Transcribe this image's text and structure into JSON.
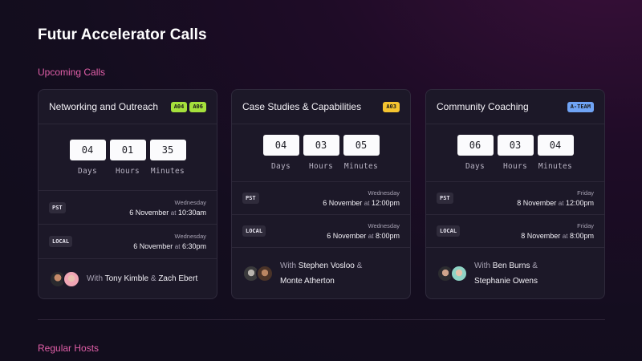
{
  "page_title": "Futur Accelerator Calls",
  "sections": {
    "upcoming_label": "Upcoming Calls",
    "hosts_label": "Regular Hosts"
  },
  "cards": [
    {
      "title": "Networking and Outreach",
      "tags": [
        {
          "label": "A04",
          "color": "#a5e03c"
        },
        {
          "label": "A06",
          "color": "#a5e03c"
        }
      ],
      "countdown": {
        "days": "04",
        "hours": "01",
        "minutes": "35",
        "days_label": "Days",
        "hours_label": "Hours",
        "minutes_label": "Minutes"
      },
      "times": [
        {
          "tz": "PST",
          "day": "Wednesday",
          "date": "6 November",
          "at": "at",
          "time": "10:30am"
        },
        {
          "tz": "LOCAL",
          "day": "Wednesday",
          "date": "6 November",
          "at": "at",
          "time": "6:30pm"
        }
      ],
      "hosts": {
        "prefix": "With",
        "host1": "Tony Kimble",
        "amp": "&",
        "host2": "Zach Ebert"
      },
      "avatars": [
        "avatar-tony-kimble",
        "avatar-zach-ebert"
      ]
    },
    {
      "title": "Case Studies & Capabilities",
      "tags": [
        {
          "label": "A03",
          "color": "#f5c430"
        }
      ],
      "countdown": {
        "days": "04",
        "hours": "03",
        "minutes": "05",
        "days_label": "Days",
        "hours_label": "Hours",
        "minutes_label": "Minutes"
      },
      "times": [
        {
          "tz": "PST",
          "day": "Wednesday",
          "date": "6 November",
          "at": "at",
          "time": "12:00pm"
        },
        {
          "tz": "LOCAL",
          "day": "Wednesday",
          "date": "6 November",
          "at": "at",
          "time": "8:00pm"
        }
      ],
      "hosts": {
        "prefix": "With",
        "host1": "Stephen Vosloo",
        "amp": "&",
        "host2": "Monte Atherton"
      },
      "avatars": [
        "avatar-stephen-vosloo",
        "avatar-monte-atherton"
      ]
    },
    {
      "title": "Community Coaching",
      "tags": [
        {
          "label": "A-TEAM",
          "color": "#6fa3f5"
        }
      ],
      "countdown": {
        "days": "06",
        "hours": "03",
        "minutes": "04",
        "days_label": "Days",
        "hours_label": "Hours",
        "minutes_label": "Minutes"
      },
      "times": [
        {
          "tz": "PST",
          "day": "Friday",
          "date": "8 November",
          "at": "at",
          "time": "12:00pm"
        },
        {
          "tz": "LOCAL",
          "day": "Friday",
          "date": "8 November",
          "at": "at",
          "time": "8:00pm"
        }
      ],
      "hosts": {
        "prefix": "With",
        "host1": "Ben Burns",
        "amp": "&",
        "host2": "Stephanie Owens"
      },
      "avatars": [
        "avatar-ben-burns",
        "avatar-stephanie-owens"
      ]
    }
  ],
  "colors": {
    "accent_pink": "#e15fa8",
    "card_bg": "#1c1828"
  }
}
